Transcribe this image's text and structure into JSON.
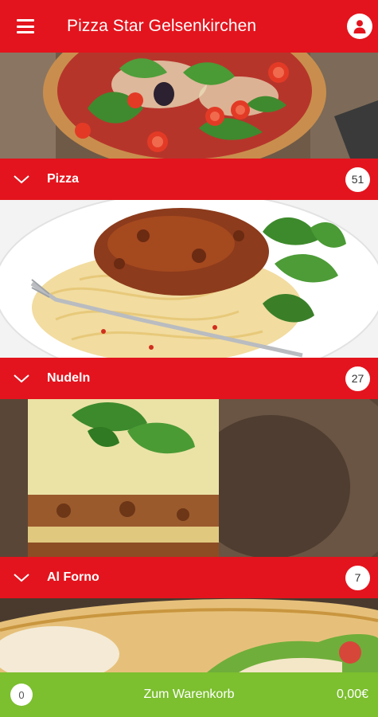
{
  "app": {
    "title": "Pizza Star Gelsenkirchen"
  },
  "icons": {
    "menu": "hamburger-menu-icon",
    "account": "person-icon",
    "expand": "chevron-down-icon"
  },
  "colors": {
    "primary": "#e3141d",
    "cart": "#7cbf2f"
  },
  "categories": [
    {
      "label": "Pizza",
      "count": "51"
    },
    {
      "label": "Nudeln",
      "count": "27"
    },
    {
      "label": "Al Forno",
      "count": "7"
    }
  ],
  "cart": {
    "count": "0",
    "label": "Zum Warenkorb",
    "total": "0,00€"
  }
}
